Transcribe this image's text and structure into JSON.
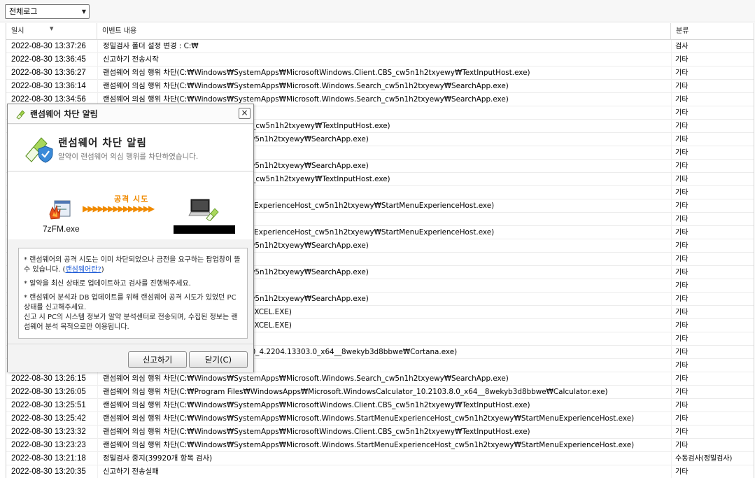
{
  "toolbar": {
    "filter_value": "전체로그"
  },
  "grid": {
    "columns": {
      "date": "일시",
      "event": "이벤트 내용",
      "category": "분류"
    },
    "rows": [
      {
        "date": "2022-08-30 13:37:26",
        "event": "정밀검사 폴더 설정 변경 : C:₩",
        "category": "검사"
      },
      {
        "date": "2022-08-30 13:36:45",
        "event": "신고하기 전송시작",
        "category": "기타"
      },
      {
        "date": "2022-08-30 13:36:27",
        "event": "랜섬웨어 의심 행위 차단(C:₩Windows₩SystemApps₩MicrosoftWindows.Client.CBS_cw5n1h2txyewy₩TextInputHost.exe)",
        "category": "기타"
      },
      {
        "date": "2022-08-30 13:36:14",
        "event": "랜섬웨어 의심 행위 차단(C:₩Windows₩SystemApps₩Microsoft.Windows.Search_cw5n1h2txyewy₩SearchApp.exe)",
        "category": "기타"
      },
      {
        "date": "2022-08-30 13:34:56",
        "event": "랜섬웨어 의심 행위 차단(C:₩Windows₩SystemApps₩Microsoft.Windows.Search_cw5n1h2txyewy₩SearchApp.exe)",
        "category": "기타"
      },
      {
        "date": "",
        "event": "",
        "category": "기타"
      },
      {
        "date": "",
        "event": "stemApps₩MicrosoftWindows.Client.CBS_cw5n1h2txyewy₩TextInputHost.exe)",
        "category": "기타"
      },
      {
        "date": "",
        "event": "stemApps₩Microsoft.Windows.Search_cw5n1h2txyewy₩SearchApp.exe)",
        "category": "기타"
      },
      {
        "date": "",
        "event": "",
        "category": "기타"
      },
      {
        "date": "",
        "event": "stemApps₩Microsoft.Windows.Search_cw5n1h2txyewy₩SearchApp.exe)",
        "category": "기타"
      },
      {
        "date": "",
        "event": "stemApps₩MicrosoftWindows.Client.CBS_cw5n1h2txyewy₩TextInputHost.exe)",
        "category": "기타"
      },
      {
        "date": "",
        "event": "",
        "category": "기타"
      },
      {
        "date": "",
        "event": "stemApps₩Microsoft.Windows.StartMenuExperienceHost_cw5n1h2txyewy₩StartMenuExperienceHost.exe)",
        "category": "기타"
      },
      {
        "date": "",
        "event": "",
        "category": "기타"
      },
      {
        "date": "",
        "event": "stemApps₩Microsoft.Windows.StartMenuExperienceHost_cw5n1h2txyewy₩StartMenuExperienceHost.exe)",
        "category": "기타"
      },
      {
        "date": "",
        "event": "stemApps₩Microsoft.Windows.Search_cw5n1h2txyewy₩SearchApp.exe)",
        "category": "기타"
      },
      {
        "date": "",
        "event": "",
        "category": "기타"
      },
      {
        "date": "",
        "event": "stemApps₩Microsoft.Windows.Search_cw5n1h2txyewy₩SearchApp.exe)",
        "category": "기타"
      },
      {
        "date": "",
        "event": "",
        "category": "기타"
      },
      {
        "date": "",
        "event": "stemApps₩Microsoft.Windows.Search_cw5n1h2txyewy₩SearchApp.exe)",
        "category": "기타"
      },
      {
        "date": "",
        "event": "x86)₩Microsoft Office₩root₩Office16₩EXCEL.EXE)",
        "category": "기타"
      },
      {
        "date": "",
        "event": "x86)₩Microsoft Office₩root₩Office16₩EXCEL.EXE)",
        "category": "기타"
      },
      {
        "date": "",
        "event": "",
        "category": "기타"
      },
      {
        "date": "",
        "event": "WindowsApps₩Microsoft.549981C3F5F10_4.2204.13303.0_x64__8wekyb3d8bbwe₩Cortana.exe)",
        "category": "기타"
      },
      {
        "date": "",
        "event": "",
        "category": "기타"
      },
      {
        "date": "2022-08-30 13:26:15",
        "event": "랜섬웨어 의심 행위 차단(C:₩Windows₩SystemApps₩Microsoft.Windows.Search_cw5n1h2txyewy₩SearchApp.exe)",
        "category": "기타"
      },
      {
        "date": "2022-08-30 13:26:05",
        "event": "랜섬웨어 의심 행위 차단(C:₩Program Files₩WindowsApps₩Microsoft.WindowsCalculator_10.2103.8.0_x64__8wekyb3d8bbwe₩Calculator.exe)",
        "category": "기타"
      },
      {
        "date": "2022-08-30 13:25:51",
        "event": "랜섬웨어 의심 행위 차단(C:₩Windows₩SystemApps₩MicrosoftWindows.Client.CBS_cw5n1h2txyewy₩TextInputHost.exe)",
        "category": "기타"
      },
      {
        "date": "2022-08-30 13:25:42",
        "event": "랜섬웨어 의심 행위 차단(C:₩Windows₩SystemApps₩Microsoft.Windows.StartMenuExperienceHost_cw5n1h2txyewy₩StartMenuExperienceHost.exe)",
        "category": "기타"
      },
      {
        "date": "2022-08-30 13:23:32",
        "event": "랜섬웨어 의심 행위 차단(C:₩Windows₩SystemApps₩MicrosoftWindows.Client.CBS_cw5n1h2txyewy₩TextInputHost.exe)",
        "category": "기타"
      },
      {
        "date": "2022-08-30 13:23:23",
        "event": "랜섬웨어 의심 행위 차단(C:₩Windows₩SystemApps₩Microsoft.Windows.StartMenuExperienceHost_cw5n1h2txyewy₩StartMenuExperienceHost.exe)",
        "category": "기타"
      },
      {
        "date": "2022-08-30 13:21:18",
        "event": "정밀검사 중지(39920개 항목 검사)",
        "category": "수동검사(정밀검사)"
      },
      {
        "date": "2022-08-30 13:20:35",
        "event": "신고하기 전송실패",
        "category": "기타"
      }
    ]
  },
  "dialog": {
    "title": "랜섬웨어 차단 알림",
    "heading": "랜섬웨어 차단 알림",
    "subheading": "알약이 랜섬웨어 의심 행위를 차단하였습니다.",
    "attack_label": "공격 시도",
    "arrows": "▶▶▶▶▶▶▶▶▶▶▶▶▶▶",
    "source_name": "7zFM.exe",
    "notice": {
      "line1": "* 랜섬웨어의 공격 시도는 이미 차단되었으나 금전을 요구하는 팝업창이 뜰 수 있습니다. (",
      "link": "랜섬웨어란?",
      "line1_end": ")",
      "line2": "* 알약을 최신 상태로 업데이트하고 검사를 진행해주세요.",
      "line3": "* 랜섬웨어 분석과 DB 업데이트를 위해 랜섬웨어 공격 시도가 있었던 PC 상태를 신고해주세요.",
      "line4": "신고 시 PC의 시스템 정보가 알약 분석센터로 전송되며, 수집된 정보는 랜섬웨어 분석 목적으로만 이용됩니다."
    },
    "report_button": "신고하기",
    "close_button": "닫기(C)",
    "close_x": "×"
  }
}
